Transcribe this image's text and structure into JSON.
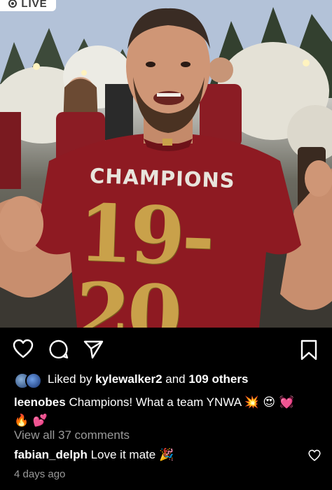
{
  "live_badge": {
    "label": "LIVE"
  },
  "photo": {
    "shirt_word": "CHAMPIONS",
    "shirt_years": "19-20",
    "bg_shirt_number": "20",
    "bg_shirt_word": "PIONS"
  },
  "actions": {
    "like_icon": "heart-outline-icon",
    "comment_icon": "comment-bubble-icon",
    "share_icon": "paper-plane-icon",
    "save_icon": "bookmark-icon"
  },
  "likes": {
    "prefix": "Liked by",
    "user": "kylewalker2",
    "connector": "and",
    "others": "109 others"
  },
  "caption": {
    "username": "leenobes",
    "text": "Champions! What a team YNWA",
    "emoji_line1": "💥 😍 💓",
    "emoji_line2": "🔥 💕"
  },
  "comments": {
    "view_all": "View all 37 comments",
    "top_comment": {
      "username": "fabian_delph",
      "text": "Love it mate",
      "emoji": "🎉"
    }
  },
  "timestamp": "4 days ago",
  "colors": {
    "shirt_red": "#8e1a22",
    "gold": "#c9a14a",
    "muted_text": "#9a9a9a"
  }
}
